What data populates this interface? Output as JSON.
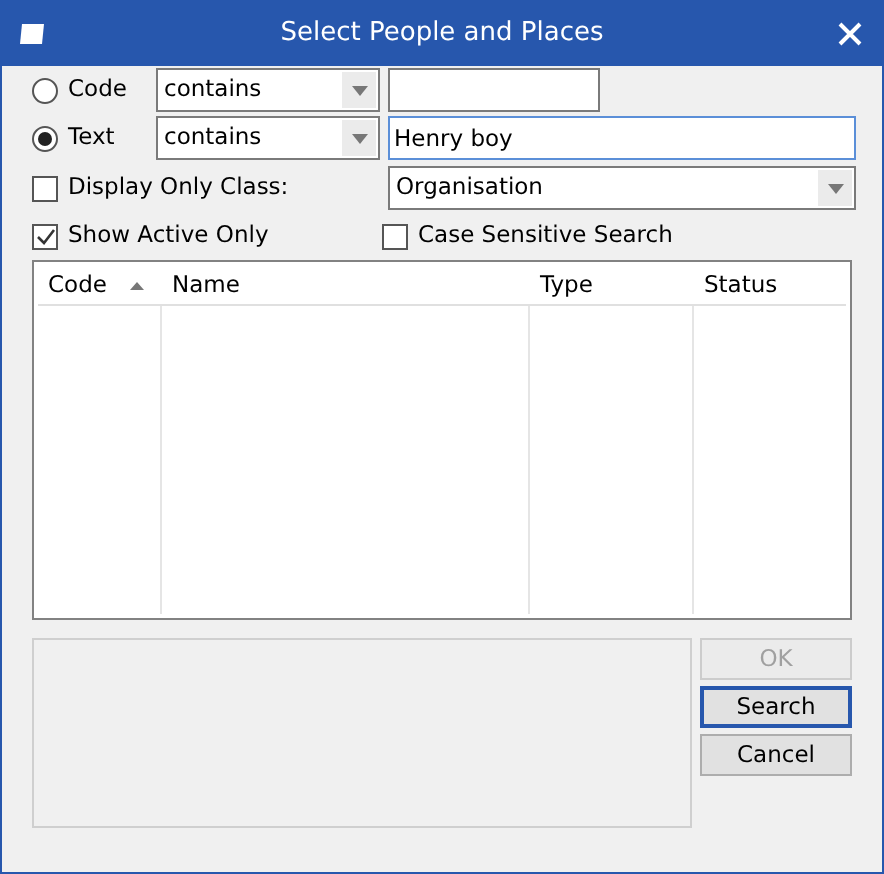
{
  "window": {
    "title": "Select People and Places"
  },
  "search_rows": [
    {
      "label": "Code",
      "selected": false,
      "operator": "contains",
      "value": ""
    },
    {
      "label": "Text",
      "selected": true,
      "operator": "contains",
      "value": "Henry boy"
    }
  ],
  "class_filter": {
    "label": "Display Only Class:",
    "checked": false,
    "value": "Organisation"
  },
  "show_active": {
    "label": "Show Active Only",
    "checked": true
  },
  "case_sensitive": {
    "label": "Case Sensitive Search",
    "checked": false
  },
  "table": {
    "columns": [
      {
        "label": "Code",
        "sorted": true
      },
      {
        "label": "Name",
        "sorted": false
      },
      {
        "label": "Type",
        "sorted": false
      },
      {
        "label": "Status",
        "sorted": false
      }
    ]
  },
  "buttons": [
    {
      "label": "OK",
      "disabled": true,
      "default": false
    },
    {
      "label": "Search",
      "disabled": false,
      "default": true
    },
    {
      "label": "Cancel",
      "disabled": false,
      "default": false
    }
  ]
}
